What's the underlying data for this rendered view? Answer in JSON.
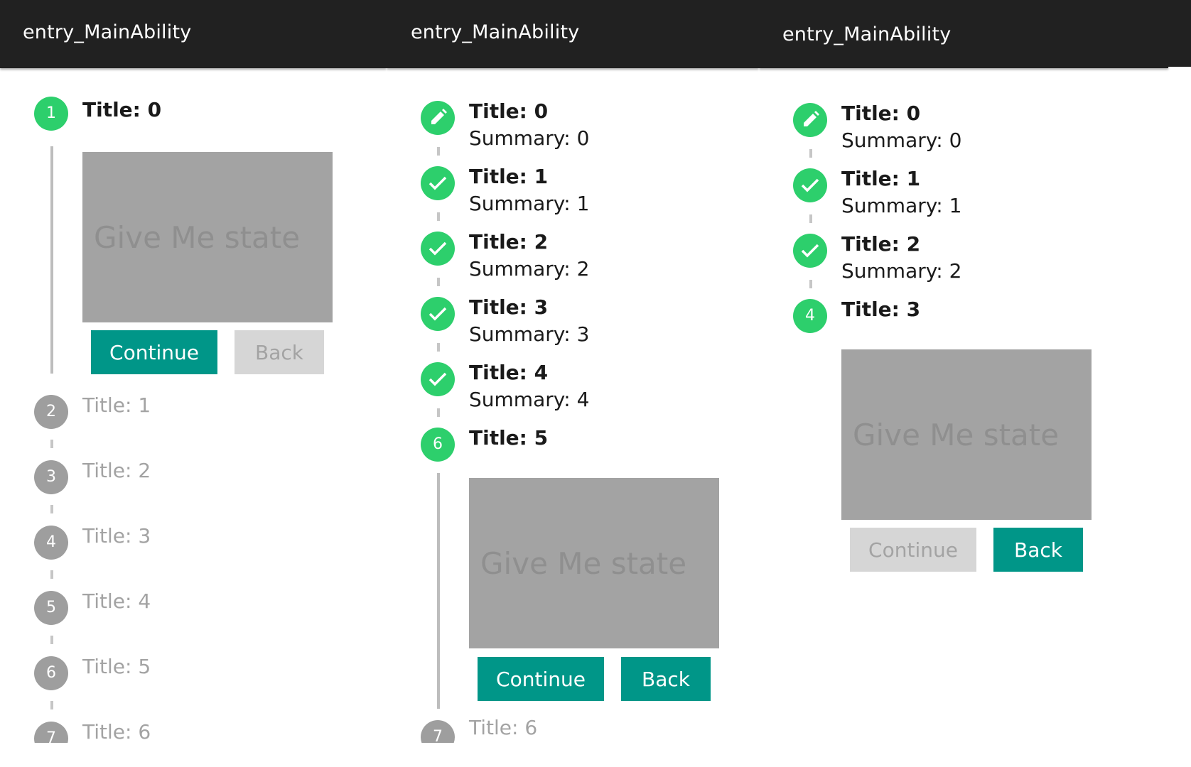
{
  "panels": [
    {
      "app_title": "entry_MainAbility",
      "steps": [
        {
          "number": "1",
          "title": "Title: 0",
          "state": "active"
        },
        {
          "number": "2",
          "title": "Title: 1",
          "state": "todo"
        },
        {
          "number": "3",
          "title": "Title: 2",
          "state": "todo"
        },
        {
          "number": "4",
          "title": "Title: 3",
          "state": "todo"
        },
        {
          "number": "5",
          "title": "Title: 4",
          "state": "todo"
        },
        {
          "number": "6",
          "title": "Title: 5",
          "state": "todo"
        },
        {
          "number": "7",
          "title": "Title: 6",
          "state": "todo"
        }
      ],
      "content_text": "Give Me state",
      "continue_label": "Continue",
      "back_label": "Back",
      "continue_enabled": true,
      "back_enabled": false
    },
    {
      "app_title": "entry_MainAbility",
      "steps": [
        {
          "icon": "pencil-icon",
          "title": "Title: 0",
          "summary": "Summary: 0",
          "state": "editing"
        },
        {
          "icon": "check-icon",
          "title": "Title: 1",
          "summary": "Summary: 1",
          "state": "complete"
        },
        {
          "icon": "check-icon",
          "title": "Title: 2",
          "summary": "Summary: 2",
          "state": "complete"
        },
        {
          "icon": "check-icon",
          "title": "Title: 3",
          "summary": "Summary: 3",
          "state": "complete"
        },
        {
          "icon": "check-icon",
          "title": "Title: 4",
          "summary": "Summary: 4",
          "state": "complete"
        },
        {
          "number": "6",
          "title": "Title: 5",
          "state": "active"
        },
        {
          "number": "7",
          "title": "Title: 6",
          "state": "todo"
        }
      ],
      "content_text": "Give Me state",
      "continue_label": "Continue",
      "back_label": "Back",
      "continue_enabled": true,
      "back_enabled": true
    },
    {
      "app_title": "entry_MainAbility",
      "steps": [
        {
          "icon": "pencil-icon",
          "title": "Title: 0",
          "summary": "Summary: 0",
          "state": "editing"
        },
        {
          "icon": "check-icon",
          "title": "Title: 1",
          "summary": "Summary: 1",
          "state": "complete"
        },
        {
          "icon": "check-icon",
          "title": "Title: 2",
          "summary": "Summary: 2",
          "state": "complete"
        },
        {
          "number": "4",
          "title": "Title: 3",
          "state": "active"
        }
      ],
      "content_text": "Give Me state",
      "continue_label": "Continue",
      "back_label": "Back",
      "continue_enabled": false,
      "back_enabled": true
    }
  ],
  "colors": {
    "app_bar": "#212121",
    "step_active": "#2dcf6c",
    "step_inactive": "#9e9e9e",
    "button_primary": "#009688",
    "button_disabled": "#d6d6d6",
    "content_box": "#a3a3a3"
  }
}
